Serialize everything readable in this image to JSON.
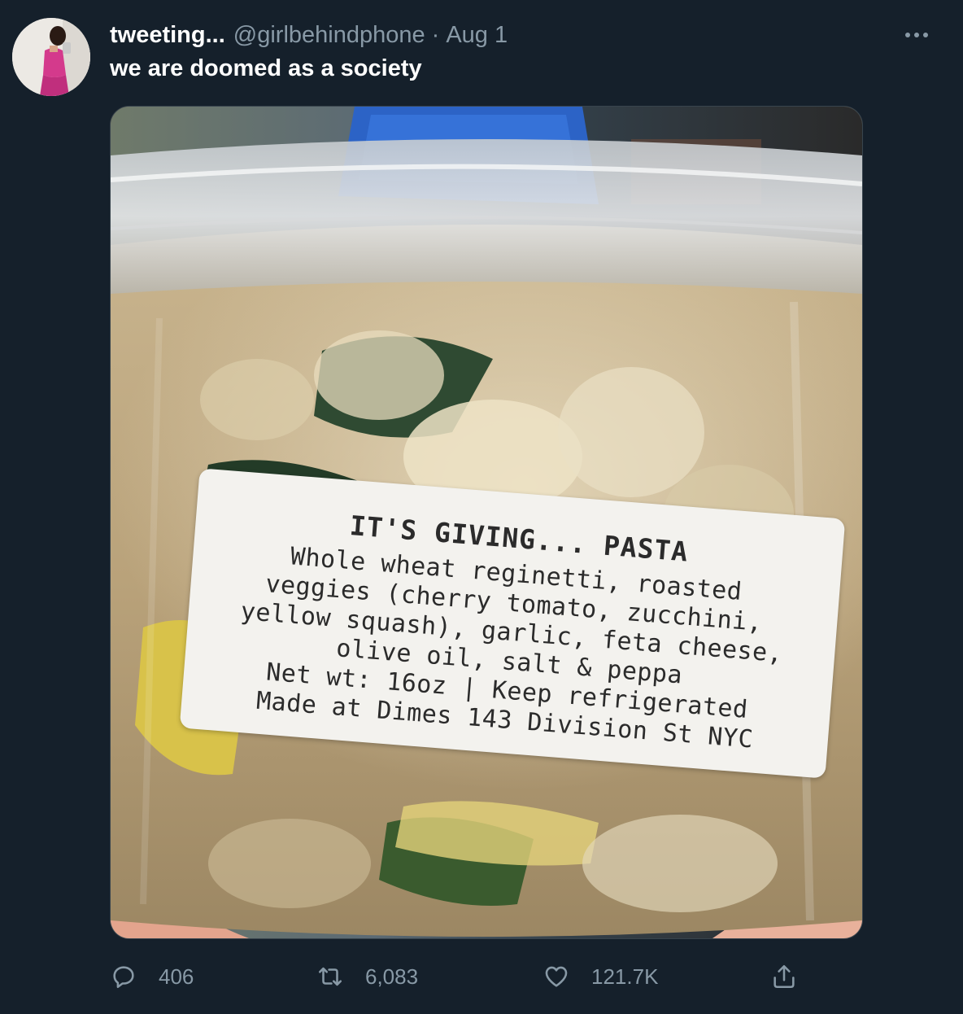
{
  "tweet": {
    "display_name": "tweeting...",
    "handle": "@girlbehindphone",
    "separator": "·",
    "timestamp": "Aug 1",
    "text": "we are doomed as a society",
    "avatar_icon": "profile-photo",
    "more_icon": "more-horizontal-icon"
  },
  "media": {
    "label": {
      "title": "IT'S GIVING... PASTA",
      "lines": [
        "Whole wheat reginetti, roasted",
        "veggies (cherry tomato, zucchini,",
        "yellow squash), garlic, feta cheese,",
        "olive oil, salt & peppa",
        "Net wt: 16oz | Keep refrigerated",
        "Made at Dimes 143 Division St NYC"
      ]
    }
  },
  "actions": {
    "reply": {
      "icon": "reply-icon",
      "count": "406"
    },
    "retweet": {
      "icon": "retweet-icon",
      "count": "6,083"
    },
    "like": {
      "icon": "heart-icon",
      "count": "121.7K"
    },
    "share": {
      "icon": "share-icon"
    }
  },
  "colors": {
    "background": "#15202b",
    "text_primary": "#ffffff",
    "text_secondary": "#8899a6",
    "border": "#38444d"
  }
}
